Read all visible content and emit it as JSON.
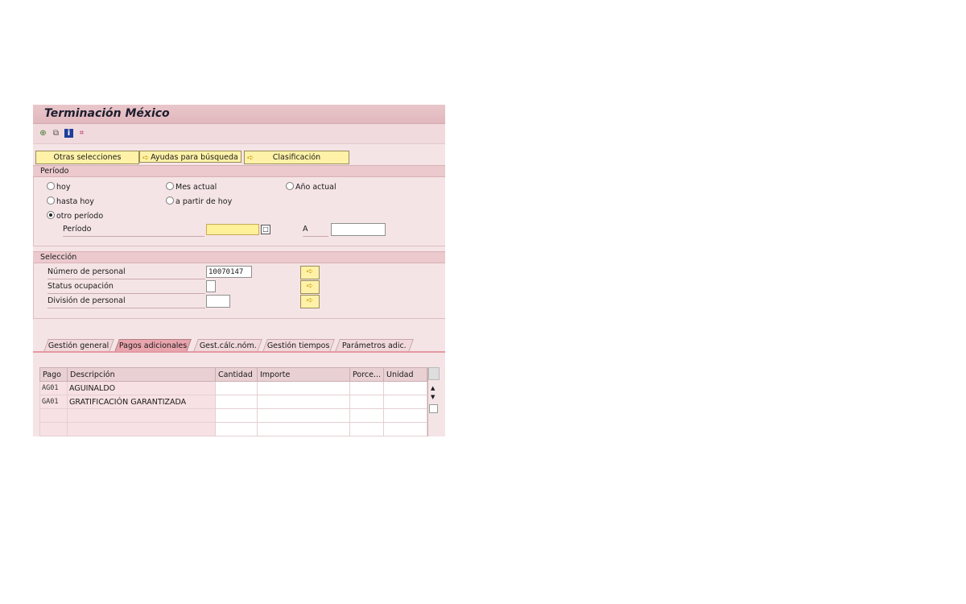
{
  "window": {
    "title": "Terminación México"
  },
  "toolbar": {
    "icons": [
      "execute-icon",
      "save-variant-icon",
      "info-icon",
      "selection-options-icon"
    ]
  },
  "selection_buttons": {
    "otras": "Otras selecciones",
    "ayudas": "Ayudas para búsqueda",
    "clasificacion": "Clasificación"
  },
  "periodo": {
    "header": "Período",
    "radios": {
      "hoy": "hoy",
      "mes_actual": "Mes actual",
      "anio_actual": "Año actual",
      "hasta_hoy": "hasta hoy",
      "a_partir": "a partir de hoy",
      "otro": "otro período"
    },
    "selected": "otro período",
    "field_label": "Período",
    "from_value": "",
    "to_label": "A",
    "to_value": ""
  },
  "seleccion": {
    "header": "Selección",
    "rows": [
      {
        "label": "Número de personal",
        "value": "10070147"
      },
      {
        "label": "Status ocupación",
        "value": ""
      },
      {
        "label": "División de personal",
        "value": ""
      }
    ]
  },
  "tabs": [
    {
      "label": "Gestión general",
      "active": false
    },
    {
      "label": "Pagos adicionales",
      "active": true
    },
    {
      "label": "Gest.cálc.nóm.",
      "active": false
    },
    {
      "label": "Gestión tiempos",
      "active": false
    },
    {
      "label": "Parámetros adic.",
      "active": false
    }
  ],
  "grid": {
    "columns": [
      "Pago",
      "Descripción",
      "Cantidad",
      "Importe",
      "Porce...",
      "Unidad"
    ],
    "rows": [
      {
        "pago": "AG01",
        "descripcion": "AGUINALDO",
        "cantidad": "",
        "importe": "",
        "porce": "",
        "unidad": ""
      },
      {
        "pago": "GA01",
        "descripcion": "GRATIFICACIÓN GARANTIZADA",
        "cantidad": "",
        "importe": "",
        "porce": "",
        "unidad": ""
      },
      {
        "pago": "",
        "descripcion": "",
        "cantidad": "",
        "importe": "",
        "porce": "",
        "unidad": ""
      },
      {
        "pago": "",
        "descripcion": "",
        "cantidad": "",
        "importe": "",
        "porce": "",
        "unidad": ""
      }
    ]
  },
  "colors": {
    "title_bg": "#e0b7bc",
    "panel_bg": "#f5e4e6",
    "button_yellow": "#fff2a8",
    "active_tab": "#e8a5ad"
  }
}
